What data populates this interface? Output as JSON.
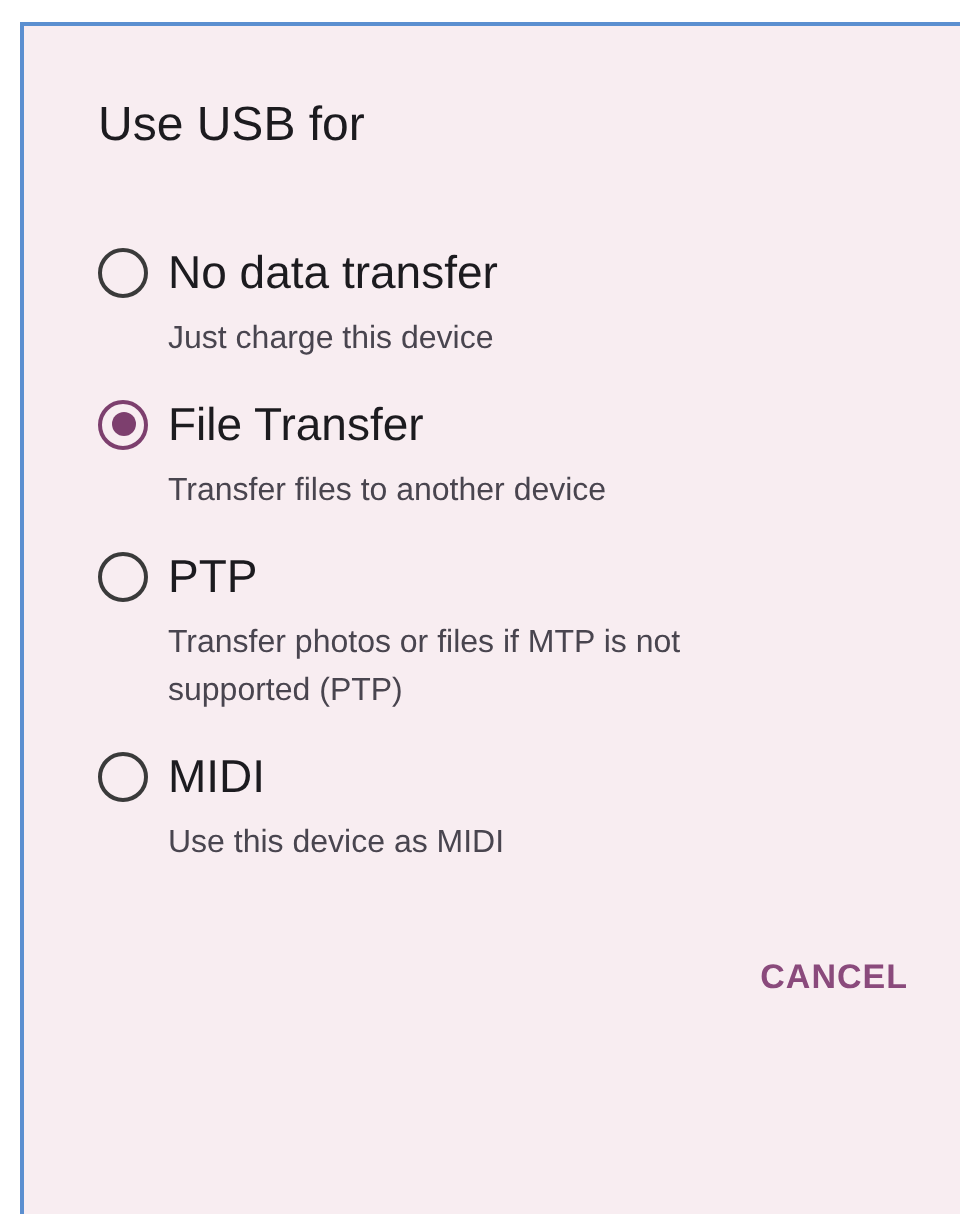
{
  "dialog": {
    "title": "Use USB for",
    "options": [
      {
        "label": "No data transfer",
        "description": "Just charge this device",
        "selected": false
      },
      {
        "label": "File Transfer",
        "description": "Transfer files to another device",
        "selected": true
      },
      {
        "label": "PTP",
        "description": "Transfer photos or files if MTP is not supported (PTP)",
        "selected": false
      },
      {
        "label": "MIDI",
        "description": "Use this device as MIDI",
        "selected": false
      }
    ],
    "buttons": [
      "CANCEL"
    ]
  }
}
